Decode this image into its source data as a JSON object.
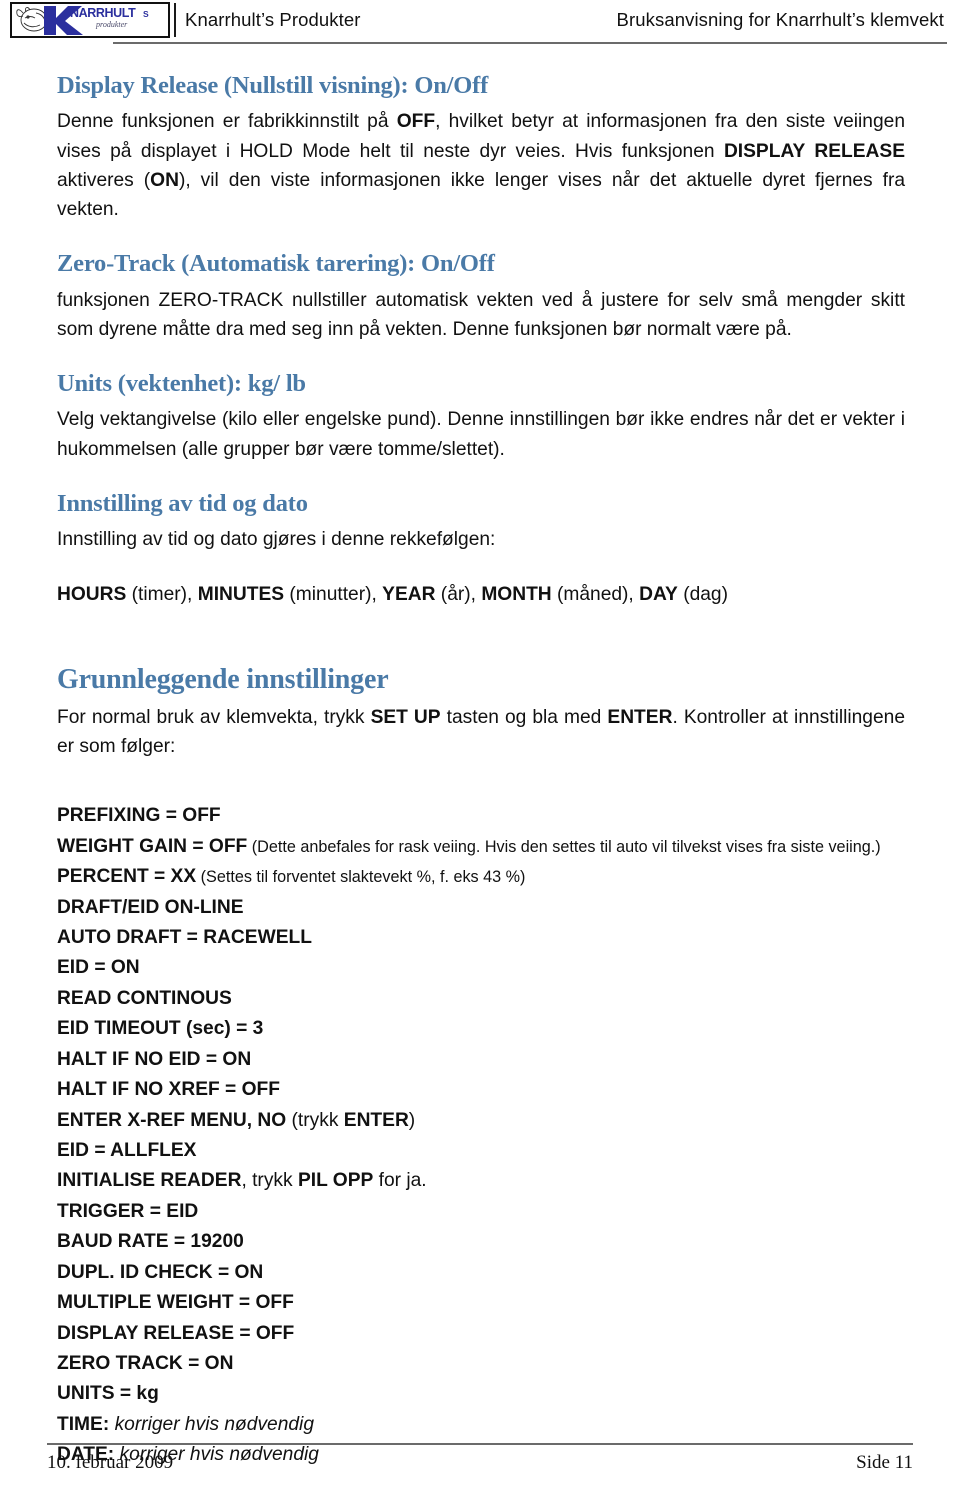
{
  "header": {
    "logo_alt": "Knarrhults Produkter logo",
    "logo_brand": "KNARRHULTS",
    "logo_sub": "produkter",
    "left_text": "Knarrhult’s Produkter",
    "right_text": "Bruksanvisning for Knarrhult’s klemvekt"
  },
  "sections": [
    {
      "heading": "Display Release (Nullstill visning): On/Off",
      "paragraph_parts": [
        {
          "text": "Denne funksjonen er fabrikkinnstilt på ",
          "bold": false
        },
        {
          "text": "OFF",
          "bold": true
        },
        {
          "text": ", hvilket betyr at informasjonen fra den siste veiingen vises på displayet i HOLD Mode helt til neste dyr veies. Hvis funksjonen ",
          "bold": false
        },
        {
          "text": "DISPLAY RELEASE",
          "bold": true
        },
        {
          "text": " aktiveres (",
          "bold": false
        },
        {
          "text": "ON",
          "bold": true
        },
        {
          "text": "), vil den viste informasjonen ikke lenger vises når det aktuelle dyret fjernes fra vekten.",
          "bold": false
        }
      ]
    },
    {
      "heading": "Zero-Track (Automatisk tarering): On/Off",
      "paragraph_parts": [
        {
          "text": "funksjonen ZERO-TRACK nullstiller automatisk vekten ved å justere for selv små mengder skitt som dyrene måtte dra med seg inn på vekten. Denne funksjonen bør normalt være på.",
          "bold": false
        }
      ]
    },
    {
      "heading": "Units (vektenhet): kg/ lb",
      "paragraph_parts": [
        {
          "text": "Velg  vektangivelse (kilo eller engelske pund).  Denne innstillingen bør ikke endres når det er vekter i hukommelsen (alle grupper bør være tomme/slettet).",
          "bold": false
        }
      ]
    },
    {
      "heading": "Innstilling av tid og dato",
      "paragraph_parts": [
        {
          "text": "Innstilling av tid og dato gjøres i denne rekkefølgen:",
          "bold": false
        }
      ]
    }
  ],
  "time_order_parts": [
    {
      "text": "HOURS",
      "bold": true
    },
    {
      "text": " (timer), ",
      "bold": false
    },
    {
      "text": "MINUTES",
      "bold": true
    },
    {
      "text": " (minutter), ",
      "bold": false
    },
    {
      "text": "YEAR",
      "bold": true
    },
    {
      "text": " (år), ",
      "bold": false
    },
    {
      "text": "MONTH",
      "bold": true
    },
    {
      "text": " (måned), ",
      "bold": false
    },
    {
      "text": "DAY",
      "bold": true
    },
    {
      "text": " (dag)",
      "bold": false
    }
  ],
  "basic_settings": {
    "heading": "Grunnleggende innstillinger",
    "intro_parts": [
      {
        "text": "For normal bruk av klemvekta, trykk ",
        "bold": false
      },
      {
        "text": "SET UP",
        "bold": true
      },
      {
        "text": " tasten og bla med ",
        "bold": false
      },
      {
        "text": "ENTER",
        "bold": true
      },
      {
        "text": ". Kontroller at innstillingene er som følger:",
        "bold": false
      }
    ],
    "items": [
      {
        "label": "PREFIXING = OFF"
      },
      {
        "label": "WEIGHT GAIN = OFF",
        "note": " (Dette anbefales for rask veiing. Hvis den settes til auto vil tilvekst vises fra siste veiing.)"
      },
      {
        "label": "PERCENT = XX",
        "note": " (Settes til forventet slaktevekt %, f. eks 43 %)"
      },
      {
        "label": "DRAFT/EID ON-LINE"
      },
      {
        "label": "AUTO DRAFT = RACEWELL"
      },
      {
        "label": "EID = ON"
      },
      {
        "label": "READ CONTINOUS"
      },
      {
        "label": "EID TIMEOUT (sec) = 3"
      },
      {
        "label": "HALT IF NO EID = ON"
      },
      {
        "label": "HALT IF NO XREF = OFF"
      },
      {
        "label": "ENTER X-REF MENU, NO",
        "plain": " (trykk ",
        "label2": "ENTER",
        "plain2": ")"
      },
      {
        "label": "EID = ALLFLEX"
      },
      {
        "label": "INITIALISE READER",
        "plain": ", trykk ",
        "label2": "PIL OPP",
        "plain2": " for ja."
      },
      {
        "label": "TRIGGER = EID"
      },
      {
        "label": "BAUD RATE = 19200"
      },
      {
        "label": "DUPL. ID CHECK = ON"
      },
      {
        "label": "MULTIPLE WEIGHT = OFF"
      },
      {
        "label": "DISPLAY RELEASE = OFF"
      },
      {
        "label": "ZERO TRACK = ON"
      },
      {
        "label": "UNITS = kg"
      },
      {
        "label": "TIME:",
        "italic": " korriger hvis nødvendig"
      },
      {
        "label": "DATE:",
        "italic": " korriger hvis nødvendig"
      }
    ]
  },
  "footer": {
    "date": "10. februar 2009",
    "page": "Side 11"
  },
  "colors": {
    "heading_blue": "#4a7aa7",
    "logo_blue": "#2b2f9e",
    "rule_gray": "#6b6b6b",
    "text_black": "#111111"
  }
}
